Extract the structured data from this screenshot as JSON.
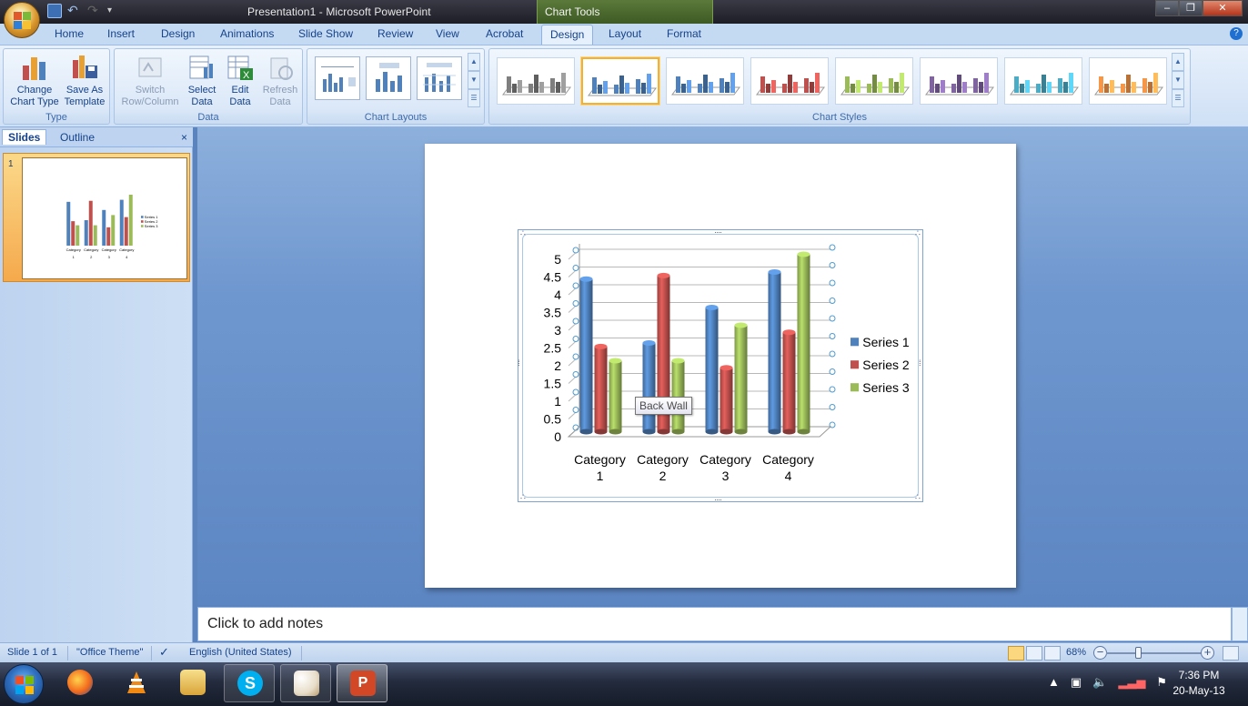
{
  "window": {
    "title": "Presentation1 - Microsoft PowerPoint",
    "contextual_tab": "Chart Tools",
    "controls": {
      "minimize": "–",
      "maximize": "❐",
      "close": "✕"
    }
  },
  "tabs": [
    "Home",
    "Insert",
    "Design",
    "Animations",
    "Slide Show",
    "Review",
    "View",
    "Acrobat",
    "Design",
    "Layout",
    "Format"
  ],
  "active_tab_index": 8,
  "ribbon": {
    "type_group": {
      "label": "Type",
      "change_chart_type": [
        "Change",
        "Chart Type"
      ],
      "save_as_template": [
        "Save As",
        "Template"
      ]
    },
    "data_group": {
      "label": "Data",
      "switch_row_column": [
        "Switch",
        "Row/Column"
      ],
      "select_data": [
        "Select",
        "Data"
      ],
      "edit_data": [
        "Edit",
        "Data"
      ],
      "refresh_data": [
        "Refresh",
        "Data"
      ]
    },
    "chart_layouts": {
      "label": "Chart Layouts"
    },
    "chart_styles": {
      "label": "Chart Styles",
      "style_colors": [
        "#7f7f7f",
        "#4f81bd",
        "#4f81bd",
        "#c0504d",
        "#9bbb59",
        "#8064a2",
        "#4bacc6",
        "#f79646"
      ],
      "selected_index": 1
    }
  },
  "slides_panel": {
    "tab_slides": "Slides",
    "tab_outline": "Outline",
    "close": "×",
    "slide_number": "1"
  },
  "chart_data": {
    "type": "bar",
    "categories": [
      [
        "Category",
        "1"
      ],
      [
        "Category",
        "2"
      ],
      [
        "Category",
        "3"
      ],
      [
        "Category",
        "4"
      ]
    ],
    "series": [
      {
        "name": "Series 1",
        "values": [
          4.3,
          2.5,
          3.5,
          4.5
        ],
        "color": "#4f81bd"
      },
      {
        "name": "Series 2",
        "values": [
          2.4,
          4.4,
          1.8,
          2.8
        ],
        "color": "#c0504d"
      },
      {
        "name": "Series 3",
        "values": [
          2.0,
          2.0,
          3.0,
          5.0
        ],
        "color": "#9bbb59"
      }
    ],
    "ylim": [
      0,
      5
    ],
    "yticks": [
      "0",
      "0.5",
      "1",
      "1.5",
      "2",
      "2.5",
      "3",
      "3.5",
      "4",
      "4.5",
      "5"
    ],
    "grid": true,
    "legend": "right"
  },
  "tooltip": "Back Wall",
  "notes_placeholder": "Click to add notes",
  "statusbar": {
    "slide": "Slide 1 of 1",
    "theme": "\"Office Theme\"",
    "language": "English (United States)",
    "zoom": "68%",
    "zoom_out": "−",
    "zoom_in": "+"
  },
  "taskbar": {
    "time": "7:36 PM",
    "date": "20-May-13",
    "apps": [
      "Firefox",
      "VLC media player",
      "Windows Explorer",
      "Skype",
      "Paint",
      "PowerPoint"
    ]
  }
}
